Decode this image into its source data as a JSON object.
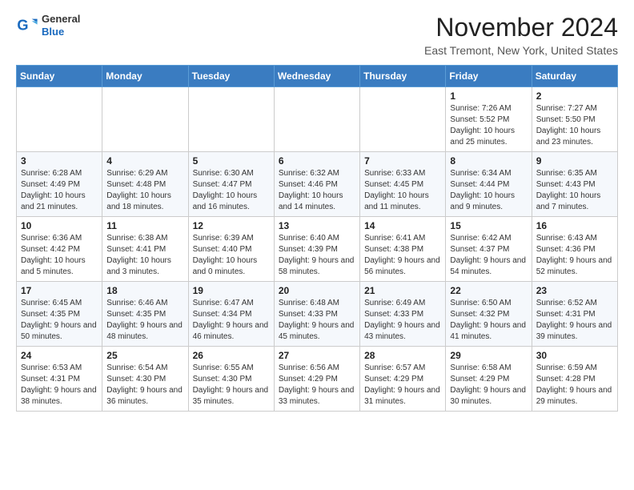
{
  "header": {
    "logo": {
      "general": "General",
      "blue": "Blue"
    },
    "title": "November 2024",
    "location": "East Tremont, New York, United States"
  },
  "calendar": {
    "days_of_week": [
      "Sunday",
      "Monday",
      "Tuesday",
      "Wednesday",
      "Thursday",
      "Friday",
      "Saturday"
    ],
    "weeks": [
      [
        {
          "day": "",
          "info": ""
        },
        {
          "day": "",
          "info": ""
        },
        {
          "day": "",
          "info": ""
        },
        {
          "day": "",
          "info": ""
        },
        {
          "day": "",
          "info": ""
        },
        {
          "day": "1",
          "info": "Sunrise: 7:26 AM\nSunset: 5:52 PM\nDaylight: 10 hours and 25 minutes."
        },
        {
          "day": "2",
          "info": "Sunrise: 7:27 AM\nSunset: 5:50 PM\nDaylight: 10 hours and 23 minutes."
        }
      ],
      [
        {
          "day": "3",
          "info": "Sunrise: 6:28 AM\nSunset: 4:49 PM\nDaylight: 10 hours and 21 minutes."
        },
        {
          "day": "4",
          "info": "Sunrise: 6:29 AM\nSunset: 4:48 PM\nDaylight: 10 hours and 18 minutes."
        },
        {
          "day": "5",
          "info": "Sunrise: 6:30 AM\nSunset: 4:47 PM\nDaylight: 10 hours and 16 minutes."
        },
        {
          "day": "6",
          "info": "Sunrise: 6:32 AM\nSunset: 4:46 PM\nDaylight: 10 hours and 14 minutes."
        },
        {
          "day": "7",
          "info": "Sunrise: 6:33 AM\nSunset: 4:45 PM\nDaylight: 10 hours and 11 minutes."
        },
        {
          "day": "8",
          "info": "Sunrise: 6:34 AM\nSunset: 4:44 PM\nDaylight: 10 hours and 9 minutes."
        },
        {
          "day": "9",
          "info": "Sunrise: 6:35 AM\nSunset: 4:43 PM\nDaylight: 10 hours and 7 minutes."
        }
      ],
      [
        {
          "day": "10",
          "info": "Sunrise: 6:36 AM\nSunset: 4:42 PM\nDaylight: 10 hours and 5 minutes."
        },
        {
          "day": "11",
          "info": "Sunrise: 6:38 AM\nSunset: 4:41 PM\nDaylight: 10 hours and 3 minutes."
        },
        {
          "day": "12",
          "info": "Sunrise: 6:39 AM\nSunset: 4:40 PM\nDaylight: 10 hours and 0 minutes."
        },
        {
          "day": "13",
          "info": "Sunrise: 6:40 AM\nSunset: 4:39 PM\nDaylight: 9 hours and 58 minutes."
        },
        {
          "day": "14",
          "info": "Sunrise: 6:41 AM\nSunset: 4:38 PM\nDaylight: 9 hours and 56 minutes."
        },
        {
          "day": "15",
          "info": "Sunrise: 6:42 AM\nSunset: 4:37 PM\nDaylight: 9 hours and 54 minutes."
        },
        {
          "day": "16",
          "info": "Sunrise: 6:43 AM\nSunset: 4:36 PM\nDaylight: 9 hours and 52 minutes."
        }
      ],
      [
        {
          "day": "17",
          "info": "Sunrise: 6:45 AM\nSunset: 4:35 PM\nDaylight: 9 hours and 50 minutes."
        },
        {
          "day": "18",
          "info": "Sunrise: 6:46 AM\nSunset: 4:35 PM\nDaylight: 9 hours and 48 minutes."
        },
        {
          "day": "19",
          "info": "Sunrise: 6:47 AM\nSunset: 4:34 PM\nDaylight: 9 hours and 46 minutes."
        },
        {
          "day": "20",
          "info": "Sunrise: 6:48 AM\nSunset: 4:33 PM\nDaylight: 9 hours and 45 minutes."
        },
        {
          "day": "21",
          "info": "Sunrise: 6:49 AM\nSunset: 4:33 PM\nDaylight: 9 hours and 43 minutes."
        },
        {
          "day": "22",
          "info": "Sunrise: 6:50 AM\nSunset: 4:32 PM\nDaylight: 9 hours and 41 minutes."
        },
        {
          "day": "23",
          "info": "Sunrise: 6:52 AM\nSunset: 4:31 PM\nDaylight: 9 hours and 39 minutes."
        }
      ],
      [
        {
          "day": "24",
          "info": "Sunrise: 6:53 AM\nSunset: 4:31 PM\nDaylight: 9 hours and 38 minutes."
        },
        {
          "day": "25",
          "info": "Sunrise: 6:54 AM\nSunset: 4:30 PM\nDaylight: 9 hours and 36 minutes."
        },
        {
          "day": "26",
          "info": "Sunrise: 6:55 AM\nSunset: 4:30 PM\nDaylight: 9 hours and 35 minutes."
        },
        {
          "day": "27",
          "info": "Sunrise: 6:56 AM\nSunset: 4:29 PM\nDaylight: 9 hours and 33 minutes."
        },
        {
          "day": "28",
          "info": "Sunrise: 6:57 AM\nSunset: 4:29 PM\nDaylight: 9 hours and 31 minutes."
        },
        {
          "day": "29",
          "info": "Sunrise: 6:58 AM\nSunset: 4:29 PM\nDaylight: 9 hours and 30 minutes."
        },
        {
          "day": "30",
          "info": "Sunrise: 6:59 AM\nSunset: 4:28 PM\nDaylight: 9 hours and 29 minutes."
        }
      ]
    ]
  }
}
